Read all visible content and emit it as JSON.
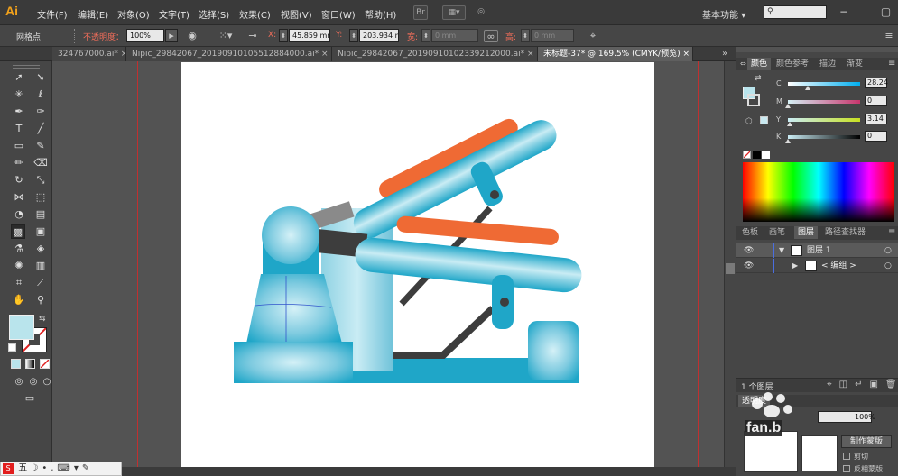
{
  "app": {
    "logo": "Ai"
  },
  "menubar": {
    "items": [
      "文件(F)",
      "编辑(E)",
      "对象(O)",
      "文字(T)",
      "选择(S)",
      "效果(C)",
      "视图(V)",
      "窗口(W)",
      "帮助(H)"
    ],
    "br_button": "Br",
    "workspace": "基本功能",
    "window_controls": "− ▢ ✕"
  },
  "control_bar": {
    "selection_label": "网格点",
    "opacity_label": "不透明度：",
    "opacity_value": "100%",
    "x_label": "X:",
    "x_value": "45.859 mm",
    "y_label": "Y:",
    "y_value": "203.934 m",
    "width_label": "宽:",
    "width_value": "0 mm",
    "height_label": "高:",
    "height_value": "0 mm"
  },
  "tabs": [
    {
      "label": "324767000.ai* ×",
      "active": false
    },
    {
      "label": "Nipic_29842067_20190910105512884000.ai* ×",
      "active": false
    },
    {
      "label": "Nipic_29842067_20190910102339212000.ai* ×",
      "active": false
    },
    {
      "label": "未标题-37* @ 169.5% (CMYK/预览) ×",
      "active": true
    }
  ],
  "tabbar_overflow": "»",
  "color_panel": {
    "tabs": [
      "颜色",
      "颜色参考",
      "描边",
      "渐变"
    ],
    "channels": [
      {
        "name": "C",
        "value": "28.24",
        "fraction": 0.28
      },
      {
        "name": "M",
        "value": "0",
        "fraction": 0.0
      },
      {
        "name": "Y",
        "value": "3.14",
        "fraction": 0.03
      },
      {
        "name": "K",
        "value": "0",
        "fraction": 0.0
      }
    ],
    "fill_color": "#b9e4ec"
  },
  "layers_panel": {
    "tabs": [
      "色板",
      "画笔",
      "图层",
      "路径查找器"
    ],
    "rows": [
      {
        "label": "图层 1"
      },
      {
        "label": "< 编组 >"
      }
    ],
    "footer": "1 个图层"
  },
  "transparency_panel": {
    "tab": "透明度",
    "value": "100%",
    "make_mask_button": "制作蒙版",
    "clip_label": "剪切",
    "invert_label": "反相蒙版"
  },
  "ime": {
    "label": "五"
  },
  "watermark": {
    "text": "fan.b"
  },
  "colors": {
    "chrome_dark": "#3a3a3a",
    "chrome_mid": "#464646",
    "canvas": "#535353",
    "artboard": "#ffffff",
    "accent_blue": "#1fa6c8",
    "accent_orange": "#ef6a34",
    "accent_dark": "#3d3d3d",
    "logo_orange": "#f3a21b"
  }
}
